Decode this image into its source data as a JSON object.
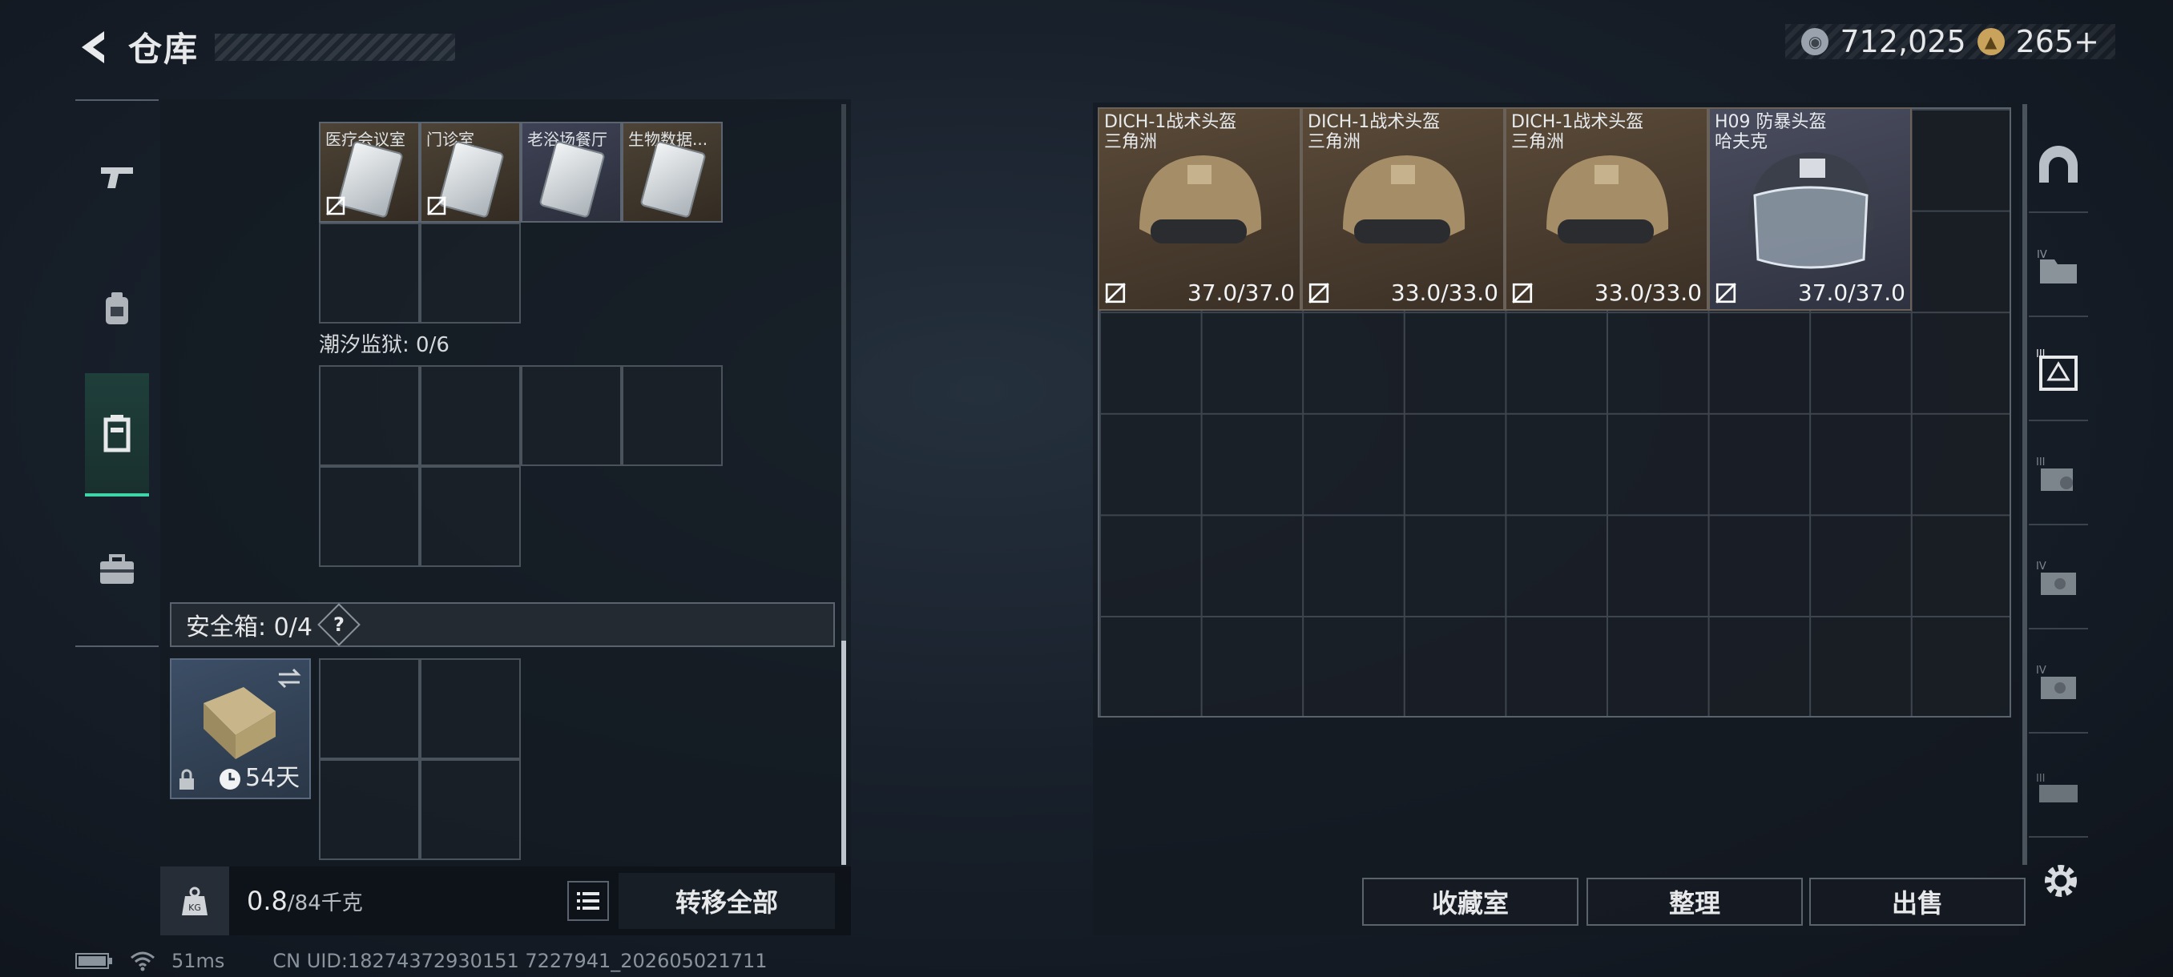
{
  "header": {
    "title": "仓库"
  },
  "currency": {
    "silver": "712,025",
    "gold": "265+"
  },
  "left_rail": {
    "items": [
      "weapon",
      "backpack",
      "vest",
      "toolbox"
    ],
    "active": 2
  },
  "left_panel": {
    "top_items": [
      "医疗会议室",
      "门诊室",
      "老浴场餐厅",
      "生物数据..."
    ],
    "section2_title": "潮汐监狱: 0/6",
    "safebox_title": "安全箱: 0/4",
    "help_symbol": "?",
    "safe_item_days": "54天",
    "weight_value": "0.8",
    "weight_max": "/84千克",
    "transfer_all": "转移全部"
  },
  "helmets": [
    {
      "name": "DICH-1战术头盔",
      "map": "三角洲",
      "durability": "37.0/37.0"
    },
    {
      "name": "DICH-1战术头盔",
      "map": "三角洲",
      "durability": "33.0/33.0"
    },
    {
      "name": "DICH-1战术头盔",
      "map": "三角洲",
      "durability": "33.0/33.0"
    },
    {
      "name": "H09 防暴头盔",
      "map": "哈夫克",
      "durability": "37.0/37.0"
    }
  ],
  "buttons": {
    "collection": "收藏室",
    "organize": "整理",
    "sell": "出售"
  },
  "status_bar": {
    "ping": "51ms",
    "uid": "CN UID:18274372930151 7227941_202605021711"
  },
  "colors": {
    "accent": "#3fd5a8",
    "background": "#18202b"
  }
}
